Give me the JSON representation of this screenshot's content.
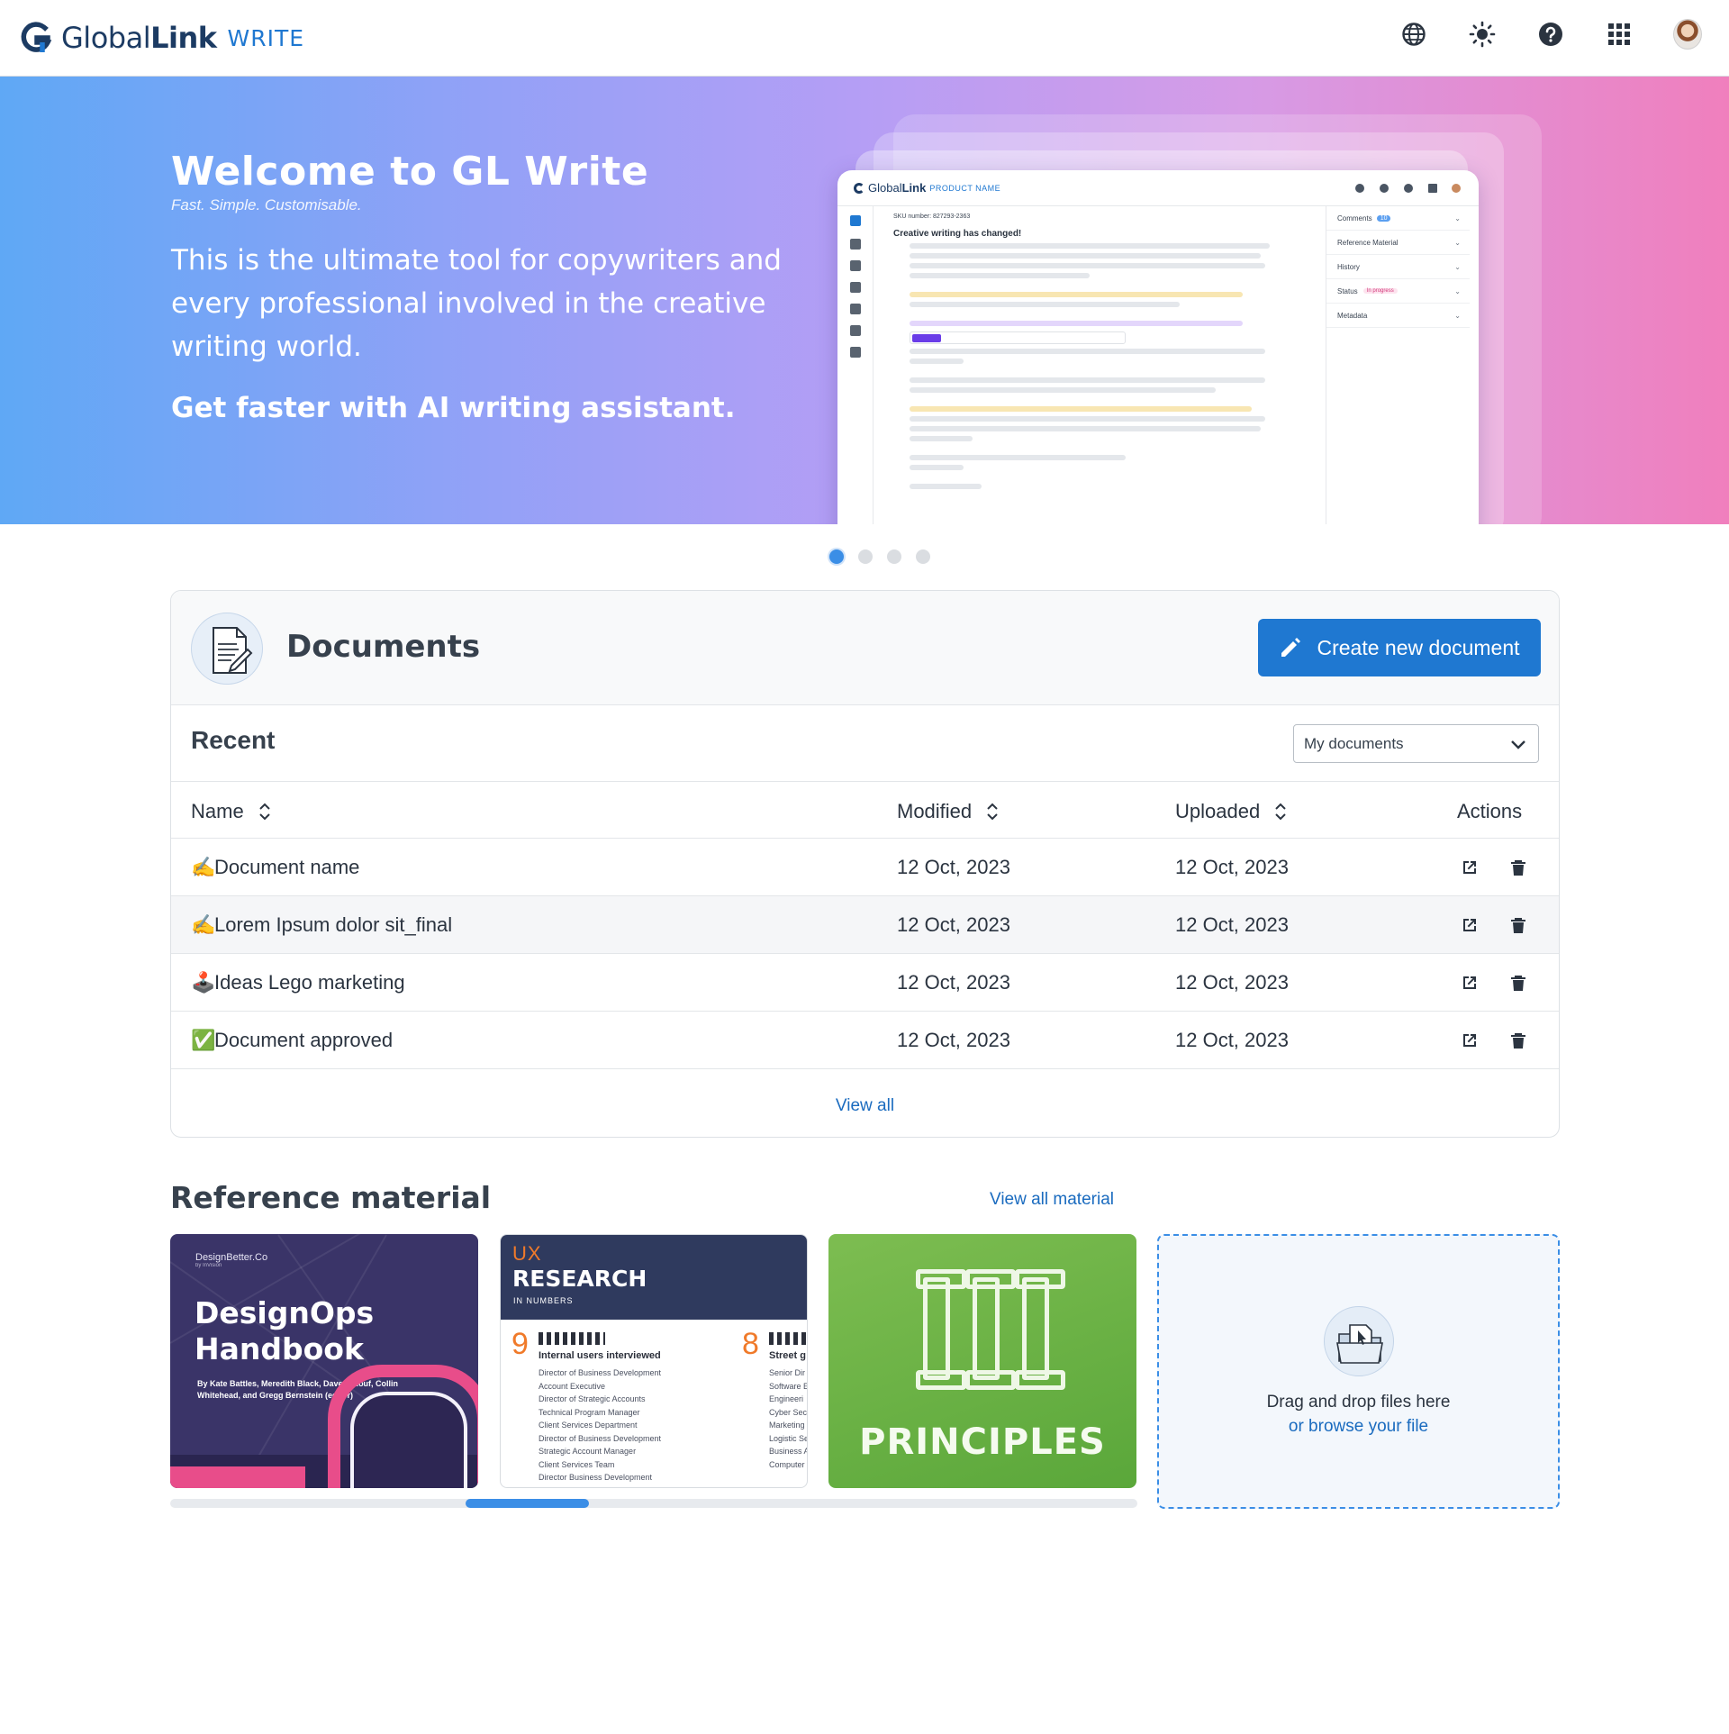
{
  "app": {
    "brand_regular": "Global",
    "brand_bold": "Link",
    "product": "WRITE"
  },
  "topbar": {
    "icons": [
      "globe-icon",
      "brightness-icon",
      "help-icon",
      "apps-grid-icon",
      "user-avatar"
    ]
  },
  "hero": {
    "title": "Welcome to GL Write",
    "tagline": "Fast. Simple. Customisable.",
    "paragraph": "This is the ultimate tool for copywriters and every professional involved in the creative writing world.",
    "cta": "Get faster with AI writing assistant.",
    "mockup": {
      "brand_regular": "Global",
      "brand_bold": "Link",
      "product": "PRODUCT NAME",
      "sku": "SKU number: 827293-2363",
      "doc_title": "Creative writing has changed!",
      "panel": [
        "Comments",
        "Reference Material",
        "History",
        "Status",
        "Metadata"
      ],
      "comments_badge": "10",
      "status_value": "In progress"
    },
    "carousel": {
      "total": 4,
      "active": 0
    }
  },
  "documents": {
    "title": "Documents",
    "create_label": "Create new document",
    "recent_label": "Recent",
    "filter_value": "My documents",
    "columns": {
      "name": "Name",
      "modified": "Modified",
      "uploaded": "Uploaded",
      "actions": "Actions"
    },
    "rows": [
      {
        "emoji": "✍️",
        "name": "Document name",
        "modified": "12 Oct, 2023",
        "uploaded": "12 Oct, 2023"
      },
      {
        "emoji": "✍️",
        "name": "Lorem Ipsum dolor sit_final",
        "modified": "12 Oct, 2023",
        "uploaded": "12 Oct, 2023"
      },
      {
        "emoji": "🕹️",
        "name": "Ideas Lego marketing",
        "modified": "12 Oct, 2023",
        "uploaded": "12 Oct, 2023"
      },
      {
        "emoji": "✅",
        "name": "Document approved",
        "modified": "12 Oct, 2023",
        "uploaded": "12 Oct, 2023"
      }
    ],
    "view_all": "View all"
  },
  "reference": {
    "title": "Reference material",
    "view_all": "View all material",
    "cards": [
      {
        "kind": "designops",
        "brand": "DesignBetter.Co",
        "brand_sub": "by InVision",
        "title_line1": "DesignOps",
        "title_line2": "Handbook",
        "authors": "By Kate Battles, Meredith Black, Dave Malouf, Collin Whitehead, and Gregg Bernstein (editor)"
      },
      {
        "kind": "ux-research",
        "ux": "UX",
        "research": "RESEARCH",
        "in_numbers": "IN NUMBERS",
        "stat1_num": "9",
        "stat1_label": "Internal users interviewed",
        "stat1_items": [
          "Director of Business Development",
          "Account Executive",
          "Director of Strategic Accounts",
          "Technical Program Manager",
          "Client Services Department",
          "Director of Business Development",
          "Strategic Account Manager",
          "Client Services Team",
          "Director Business Development"
        ],
        "stat2_num": "8",
        "stat2_label": "Street g",
        "stat2_items": [
          "Senior Dir",
          "Software E",
          "Engineeri",
          "Cyber Sec",
          "Marketing",
          "Logistic Se",
          "Business A",
          "Computer"
        ]
      },
      {
        "kind": "principles",
        "label": "PRINCIPLES"
      }
    ],
    "dropzone": {
      "line1": "Drag and drop files here",
      "line2": "or browse your file"
    },
    "scroll_position": 0.35
  },
  "colors": {
    "primary": "#1f78d1",
    "link": "#1a6bbf",
    "heading": "#37414d",
    "hero_start": "#5fa8f5",
    "hero_end": "#f07fbd"
  }
}
